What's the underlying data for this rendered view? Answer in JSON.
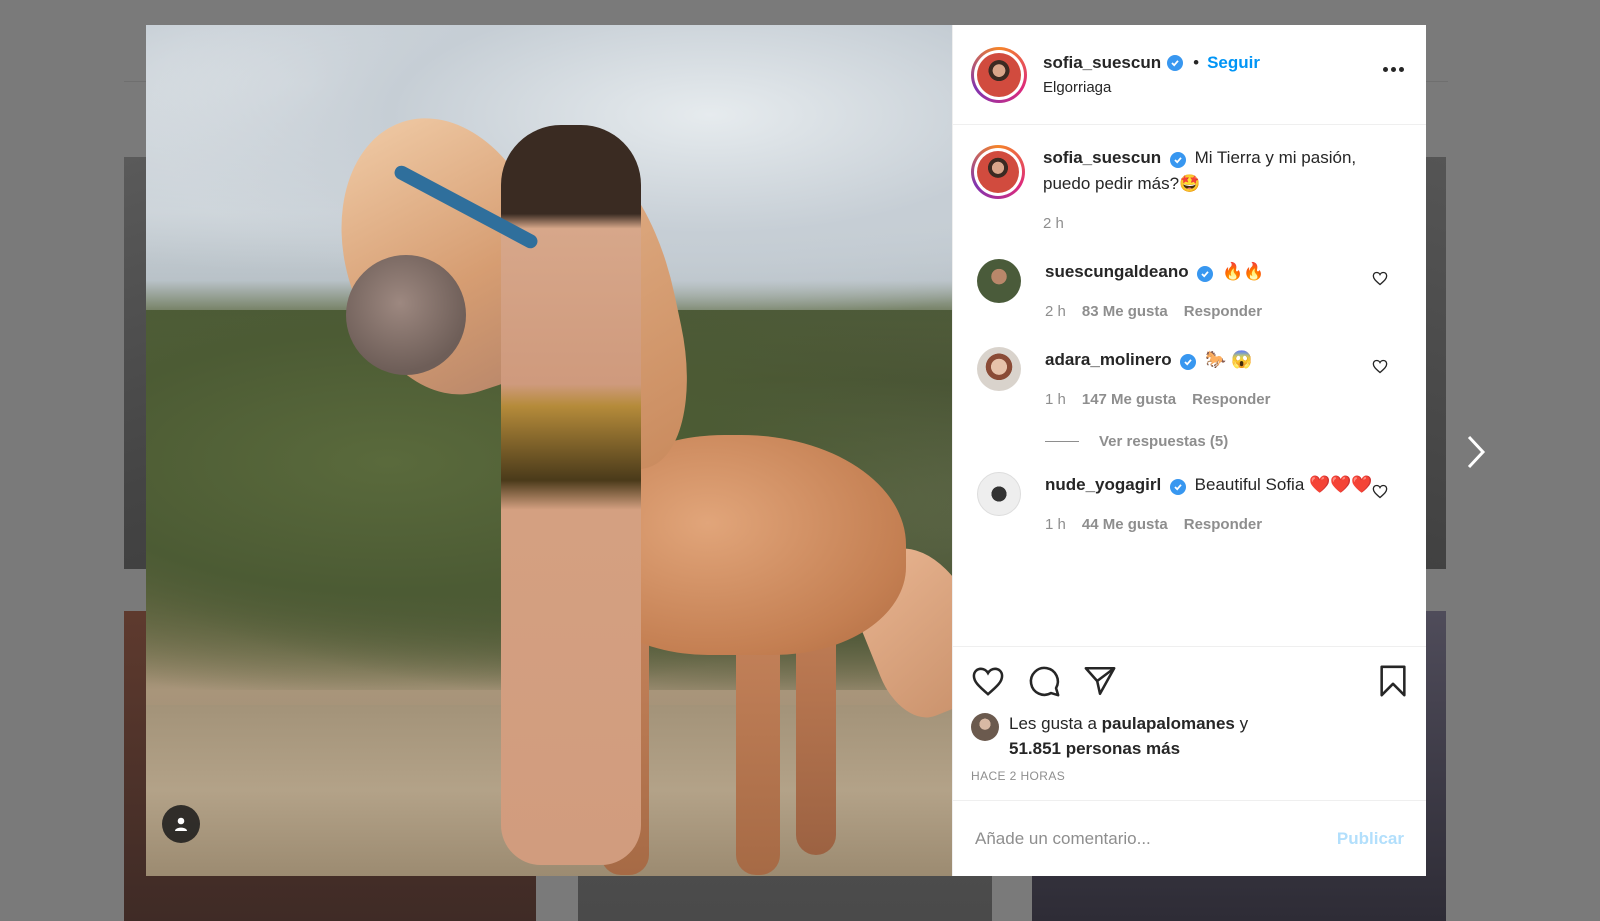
{
  "post": {
    "username": "sofia_suescun",
    "follow_label": "Seguir",
    "separator": "•",
    "location": "Elgorriaga"
  },
  "caption": {
    "username": "sofia_suescun",
    "text": "Mi Tierra y mi pasión, puedo pedir más?🤩",
    "time": "2 h"
  },
  "comments": [
    {
      "username": "suescungaldeano",
      "text": "🔥🔥",
      "time": "2 h",
      "likes": "83 Me gusta",
      "reply": "Responder"
    },
    {
      "username": "adara_molinero",
      "text": "🐎 😱",
      "time": "1 h",
      "likes": "147 Me gusta",
      "reply": "Responder",
      "view_replies": "Ver respuestas (5)"
    },
    {
      "username": "nude_yogagirl",
      "text": "Beautiful Sofia ❤️❤️❤️",
      "time": "1 h",
      "likes": "44 Me gusta",
      "reply": "Responder"
    }
  ],
  "likes": {
    "prefix": "Les gusta a",
    "user": "paulapalomanes",
    "connector": "y",
    "others": "51.851 personas más"
  },
  "timestamp": "HACE 2 HORAS",
  "add_comment": {
    "placeholder": "Añade un comentario...",
    "publish_label": "Publicar"
  },
  "colors": {
    "accent": "#0095f6",
    "verified": "#3897f0",
    "publish_disabled": "#b2dffc",
    "text": "#262626",
    "muted": "#8e8e8e"
  },
  "icons": [
    "more-options-icon",
    "verified-icon",
    "heart-icon",
    "comment-icon",
    "share-icon",
    "bookmark-icon",
    "user-tag-icon",
    "chevron-right-icon"
  ]
}
